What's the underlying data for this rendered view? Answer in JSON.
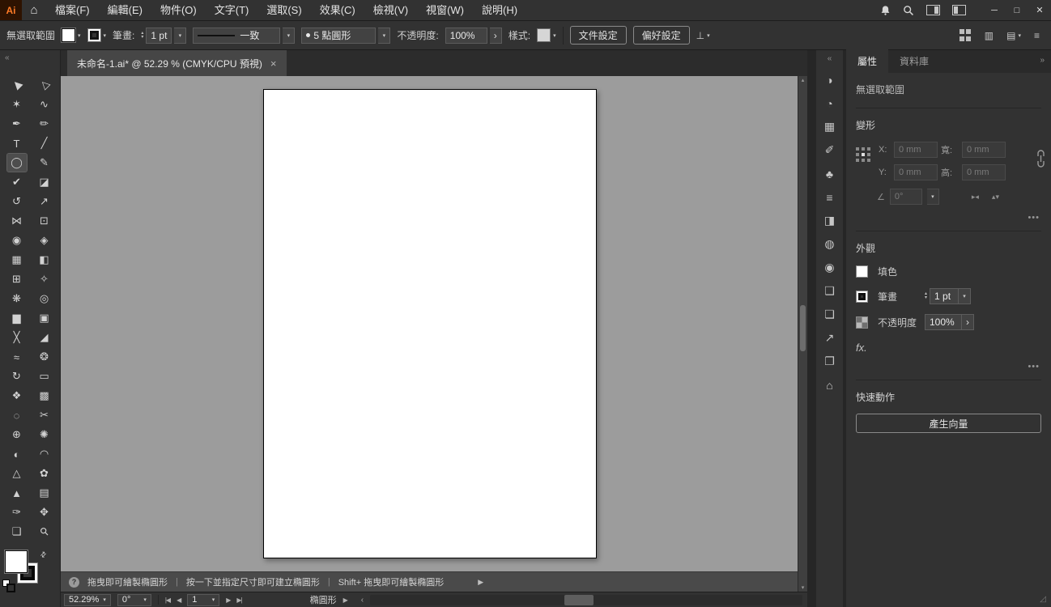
{
  "colors": {
    "panel_bg": "#323232",
    "canvas_bg": "#9c9c9c",
    "artboard": "#ffffff",
    "logo_accent": "#ff7b26"
  },
  "icons": {
    "dropdown": "▾",
    "up": "▴",
    "down": "▾",
    "chevron_right": "›",
    "collapse_left": "«",
    "collapse_right": "»",
    "more": "•••",
    "help": "?",
    "play": "▶",
    "swap": "⇄",
    "home": "⌂",
    "hamburger": "≡",
    "doc_rows": "▥",
    "doc_arrange": "▤",
    "angle": "∠",
    "align": "⊥",
    "flip_h": "▸◂",
    "flip_v": "▴▾",
    "scroll_up": "▴",
    "scroll_down": "▾",
    "scroll_left": "‹",
    "nav_first": "|◀",
    "nav_prev": "◀",
    "nav_next": "▶",
    "nav_last": "▶|",
    "grip": "◿",
    "bullet": "●"
  },
  "menubar": {
    "logo_text": "Ai",
    "items": [
      {
        "id": "file",
        "label": "檔案(F)"
      },
      {
        "id": "edit",
        "label": "編輯(E)"
      },
      {
        "id": "object",
        "label": "物件(O)"
      },
      {
        "id": "type",
        "label": "文字(T)"
      },
      {
        "id": "select",
        "label": "選取(S)"
      },
      {
        "id": "effect",
        "label": "效果(C)"
      },
      {
        "id": "view",
        "label": "檢視(V)"
      },
      {
        "id": "window",
        "label": "視窗(W)"
      },
      {
        "id": "help",
        "label": "說明(H)"
      }
    ],
    "window_controls": {
      "minimize": "─",
      "maximize": "□",
      "close": "✕"
    }
  },
  "controlbar": {
    "selection_status": "無選取範圍",
    "stroke_label": "筆畫:",
    "stroke_weight": "1 pt",
    "width_profile": "一致",
    "brush": "5 點圓形",
    "opacity_label": "不透明度:",
    "opacity_value": "100%",
    "style_label": "樣式:",
    "document_setup": "文件設定",
    "preferences": "偏好設定"
  },
  "document_tab": {
    "title": "未命名-1.ai* @ 52.29 % (CMYK/CPU 預視)",
    "close": "×"
  },
  "toolbar": {
    "tools": [
      {
        "name": "selection-tool",
        "glyph": "▶",
        "rot": -135
      },
      {
        "name": "direct-selection-tool",
        "glyph": "▷",
        "rot": -135
      },
      {
        "name": "magic-wand-tool",
        "glyph": "✶"
      },
      {
        "name": "lasso-tool",
        "glyph": "∿"
      },
      {
        "name": "pen-tool",
        "glyph": "✒"
      },
      {
        "name": "curvature-tool",
        "glyph": "✏"
      },
      {
        "name": "type-tool",
        "glyph": "T"
      },
      {
        "name": "line-segment-tool",
        "glyph": "╱"
      },
      {
        "name": "ellipse-tool",
        "glyph": "◯",
        "selected": true
      },
      {
        "name": "paintbrush-tool",
        "glyph": "✎"
      },
      {
        "name": "shaper-tool",
        "glyph": "✔"
      },
      {
        "name": "eraser-tool",
        "glyph": "◪"
      },
      {
        "name": "rotate-tool",
        "glyph": "↺"
      },
      {
        "name": "scale-tool",
        "glyph": "↗"
      },
      {
        "name": "width-tool",
        "glyph": "⋈"
      },
      {
        "name": "free-transform-tool",
        "glyph": "⊡"
      },
      {
        "name": "shape-builder-tool",
        "glyph": "◉"
      },
      {
        "name": "live-paint-bucket-tool",
        "glyph": "◈"
      },
      {
        "name": "perspective-grid-tool",
        "glyph": "▦"
      },
      {
        "name": "gradient-tool",
        "glyph": "◧"
      },
      {
        "name": "mesh-tool",
        "glyph": "⊞"
      },
      {
        "name": "eyedropper-tool",
        "glyph": "✧"
      },
      {
        "name": "symbol-sprayer-tool",
        "glyph": "❋"
      },
      {
        "name": "blend-tool",
        "glyph": "◎"
      },
      {
        "name": "column-graph-tool",
        "glyph": "▆"
      },
      {
        "name": "artboard-tool",
        "glyph": "▣"
      },
      {
        "name": "slice-tool",
        "glyph": "╳"
      },
      {
        "name": "knife-tool",
        "glyph": "◢"
      },
      {
        "name": "warp-tool",
        "glyph": "≈"
      },
      {
        "name": "twirl-tool",
        "glyph": "❂"
      },
      {
        "name": "rotate-view-tool",
        "glyph": "↻"
      },
      {
        "name": "ruler-tool",
        "glyph": "▭"
      },
      {
        "name": "symbol-shifter-tool",
        "glyph": "❖"
      },
      {
        "name": "pattern-tile-tool",
        "glyph": "▩"
      },
      {
        "name": "spiral-tool",
        "glyph": "◌"
      },
      {
        "name": "scissors-tool",
        "glyph": "✂"
      },
      {
        "name": "polar-grid-tool",
        "glyph": "⊕"
      },
      {
        "name": "crystallize-tool",
        "glyph": "✺"
      },
      {
        "name": "bloat-tool",
        "glyph": "◐"
      },
      {
        "name": "arc-tool",
        "glyph": "◠"
      },
      {
        "name": "reshape-tool",
        "glyph": "△"
      },
      {
        "name": "scallop-tool",
        "glyph": "✿"
      },
      {
        "name": "group-selection-tool",
        "glyph": "▲"
      },
      {
        "name": "grid-tool",
        "glyph": "▤"
      },
      {
        "name": "pencil-tool",
        "glyph": "✑"
      },
      {
        "name": "hand-tool",
        "glyph": "✥"
      },
      {
        "name": "print-tiling-tool",
        "glyph": "❏"
      },
      {
        "name": "zoom-tool",
        "glyph": "⚲",
        "rot": -45
      }
    ]
  },
  "icon_strip": [
    {
      "name": "color-icon",
      "glyph": "◑"
    },
    {
      "name": "color-guide-icon",
      "glyph": "◔"
    },
    {
      "name": "swatches-icon",
      "glyph": "▦"
    },
    {
      "name": "brushes-icon",
      "glyph": "✐"
    },
    {
      "name": "symbols-icon",
      "glyph": "♣"
    },
    {
      "name": "stroke-icon",
      "glyph": "≡"
    },
    {
      "name": "gradient-icon",
      "glyph": "◨"
    },
    {
      "name": "transparency-icon",
      "glyph": "◍"
    },
    {
      "name": "appearance-icon",
      "glyph": "◉"
    },
    {
      "name": "graphic-styles-icon",
      "glyph": "❑"
    },
    {
      "name": "layers-icon",
      "glyph": "❏"
    },
    {
      "name": "asset-export-icon",
      "glyph": "↗"
    },
    {
      "name": "artboards-icon",
      "glyph": "❐"
    },
    {
      "name": "libraries-icon",
      "glyph": "⌂"
    }
  ],
  "properties_panel": {
    "tabs": [
      "屬性",
      "資料庫"
    ],
    "selection_status": "無選取範圍",
    "transform": {
      "title": "變形",
      "x_label": "X:",
      "x_value": "0 mm",
      "y_label": "Y:",
      "y_value": "0 mm",
      "w_label": "寬:",
      "w_value": "0 mm",
      "h_label": "高:",
      "h_value": "0 mm",
      "angle_value": "0°"
    },
    "appearance": {
      "title": "外觀",
      "fill_label": "填色",
      "stroke_label": "筆畫",
      "stroke_weight": "1 pt",
      "opacity_label": "不透明度",
      "opacity_value": "100%",
      "fx_label": "fx."
    },
    "quick_actions": {
      "title": "快速動作",
      "generate_vector": "產生向量"
    }
  },
  "hint_bar": {
    "hints": [
      "拖曳即可繪製橢圓形",
      "按一下並指定尺寸即可建立橢圓形",
      "Shift+ 拖曳即可繪製橢圓形"
    ]
  },
  "status_bar": {
    "zoom": "52.29%",
    "rotation": "0°",
    "artboard_number": "1",
    "tool_name": "橢圓形"
  }
}
